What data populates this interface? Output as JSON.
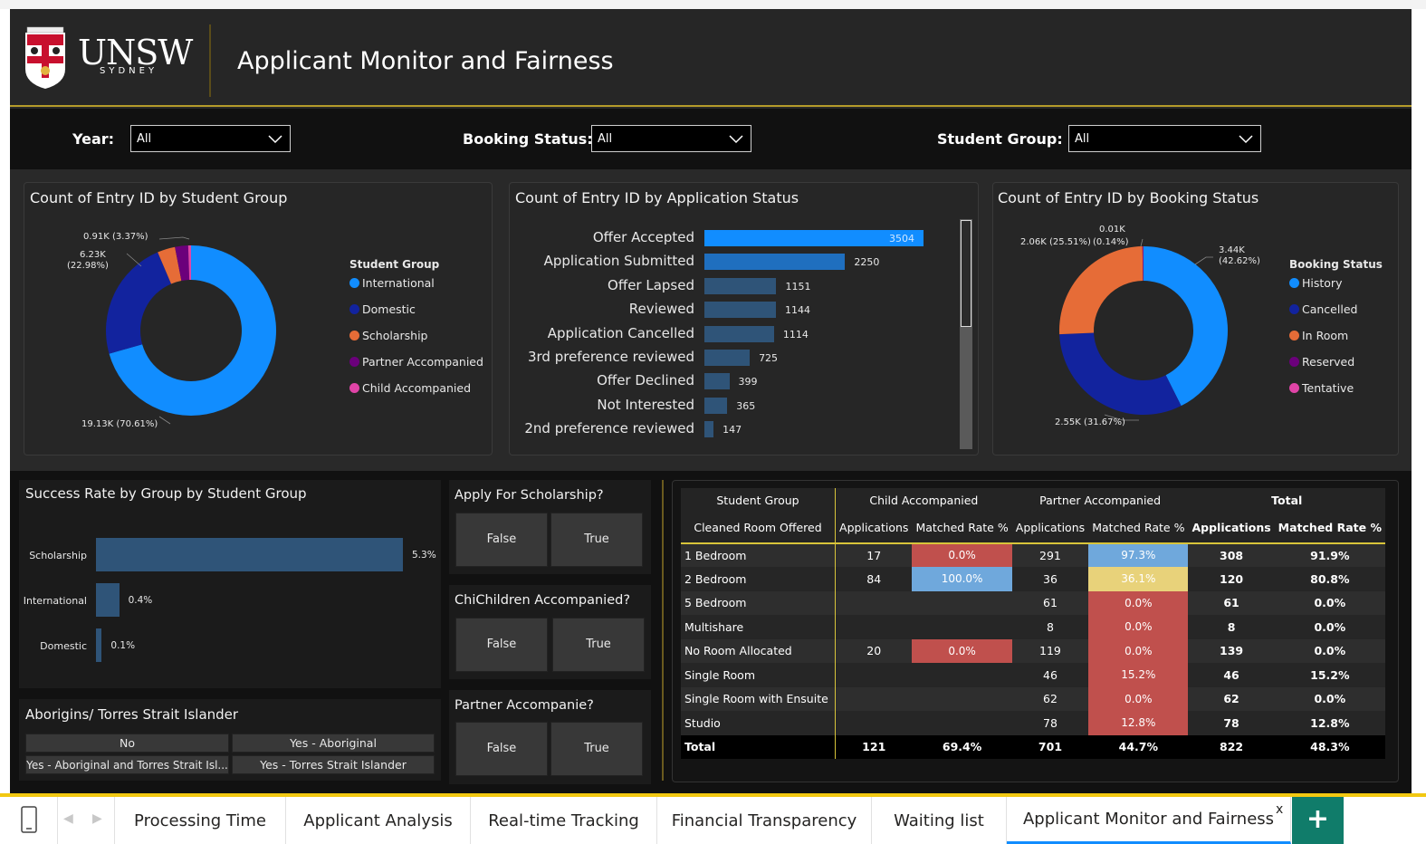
{
  "header": {
    "logo_text": "UNSW",
    "logo_subtext": "SYDNEY",
    "title": "Applicant Monitor and Fairness"
  },
  "filters": {
    "year_label": "Year:",
    "year_value": "All",
    "booking_label": "Booking Status:",
    "booking_value": "All",
    "group_label": "Student Group:",
    "group_value": "All"
  },
  "donut_group": {
    "title": "Count of Entry ID by Student Group",
    "labels": {
      "international": "19.13K (70.61%)",
      "domestic_1": "6.23K",
      "domestic_2": "(22.98%)",
      "scholarship": "0.91K (3.37%)"
    },
    "legend_title": "Student Group",
    "legend": [
      "International",
      "Domestic",
      "Scholarship",
      "Partner Accompanied",
      "Child Accompanied"
    ],
    "colors": [
      "#118dff",
      "#12239e",
      "#e66c37",
      "#6b007b",
      "#e044a7"
    ],
    "chart_data": {
      "type": "pie",
      "categories": [
        "International",
        "Domestic",
        "Scholarship",
        "Partner Accompanied",
        "Child Accompanied"
      ],
      "values": [
        70.61,
        22.98,
        3.37,
        2.5,
        0.54
      ]
    }
  },
  "bar_status": {
    "title": "Count of Entry ID by Application Status",
    "chart_data": {
      "type": "bar",
      "categories": [
        "Offer Accepted",
        "Application Submitted",
        "Offer Lapsed",
        "Reviewed",
        "Application Cancelled",
        "3rd preference reviewed",
        "Offer Declined",
        "Not Interested",
        "2nd preference reviewed"
      ],
      "values": [
        3504,
        2250,
        1151,
        1144,
        1114,
        725,
        399,
        365,
        147
      ],
      "xlim": [
        0,
        3504
      ]
    },
    "value_labels": [
      "3504",
      "2250",
      "1151",
      "1144",
      "1114",
      "725",
      "399",
      "365",
      "147"
    ]
  },
  "donut_booking": {
    "title": "Count of Entry ID by Booking Status",
    "labels": {
      "history_1": "3.44K",
      "history_2": "(42.62%)",
      "cancelled": "2.55K (31.67%)",
      "inroom": "2.06K (25.51%)",
      "reserved_1": "0.01K",
      "reserved_2": "(0.14%)"
    },
    "legend_title": "Booking Status",
    "legend": [
      "History",
      "Cancelled",
      "In Room",
      "Reserved",
      "Tentative"
    ],
    "colors": [
      "#118dff",
      "#12239e",
      "#e66c37",
      "#6b007b",
      "#e044a7"
    ],
    "chart_data": {
      "type": "pie",
      "categories": [
        "History",
        "Cancelled",
        "In Room",
        "Reserved",
        "Tentative"
      ],
      "values": [
        42.62,
        31.67,
        25.51,
        0.14,
        0.06
      ]
    }
  },
  "success_rate": {
    "title": "Success Rate by Group by Student Group",
    "chart_data": {
      "type": "bar",
      "categories": [
        "Scholarship",
        "International",
        "Domestic"
      ],
      "values": [
        5.3,
        0.4,
        0.1
      ],
      "xlim": [
        0,
        5.3
      ]
    },
    "value_labels": [
      "5.3%",
      "0.4%",
      "0.1%"
    ]
  },
  "aboriginal": {
    "title": "Aborigins/ Torres Strait Islander",
    "options": [
      "No",
      "Yes - Aboriginal",
      "Yes - Aboriginal and Torres Strait Isl...",
      "Yes - Torres Strait Islander"
    ]
  },
  "slicers": [
    {
      "title": "Apply For Scholarship?",
      "false_label": "False",
      "true_label": "True"
    },
    {
      "title": "ChiChildren Accompanied?",
      "false_label": "False",
      "true_label": "True"
    },
    {
      "title": "Partner Accompanie?",
      "false_label": "False",
      "true_label": "True"
    }
  ],
  "matrix": {
    "h_group": "Student Group",
    "h_room": "Cleaned Room Offered",
    "h_child": "Child Accompanied",
    "h_partner": "Partner Accompanied",
    "h_total": "Total",
    "h_apps": "Applications",
    "h_rate": "Matched Rate %",
    "rows": [
      {
        "room": "1 Bedroom",
        "c_apps": "17",
        "c_rate": "0.0%",
        "p_apps": "291",
        "p_rate": "97.3%",
        "t_apps": "308",
        "t_rate": "91.9%"
      },
      {
        "room": "2 Bedroom",
        "c_apps": "84",
        "c_rate": "100.0%",
        "p_apps": "36",
        "p_rate": "36.1%",
        "t_apps": "120",
        "t_rate": "80.8%"
      },
      {
        "room": "5 Bedroom",
        "c_apps": "",
        "c_rate": "",
        "p_apps": "61",
        "p_rate": "0.0%",
        "t_apps": "61",
        "t_rate": "0.0%"
      },
      {
        "room": "Multishare",
        "c_apps": "",
        "c_rate": "",
        "p_apps": "8",
        "p_rate": "0.0%",
        "t_apps": "8",
        "t_rate": "0.0%"
      },
      {
        "room": "No Room Allocated",
        "c_apps": "20",
        "c_rate": "0.0%",
        "p_apps": "119",
        "p_rate": "0.0%",
        "t_apps": "139",
        "t_rate": "0.0%"
      },
      {
        "room": "Single Room",
        "c_apps": "",
        "c_rate": "",
        "p_apps": "46",
        "p_rate": "15.2%",
        "t_apps": "46",
        "t_rate": "15.2%"
      },
      {
        "room": "Single Room with Ensuite",
        "c_apps": "",
        "c_rate": "",
        "p_apps": "62",
        "p_rate": "0.0%",
        "t_apps": "62",
        "t_rate": "0.0%"
      },
      {
        "room": "Studio",
        "c_apps": "",
        "c_rate": "",
        "p_apps": "78",
        "p_rate": "12.8%",
        "t_apps": "78",
        "t_rate": "12.8%"
      }
    ],
    "total": {
      "room": "Total",
      "c_apps": "121",
      "c_rate": "69.4%",
      "p_apps": "701",
      "p_rate": "44.7%",
      "t_apps": "822",
      "t_rate": "48.3%"
    },
    "cell_colors": {
      "red": "#c0504d",
      "blue": "#6fa8dc",
      "yellow": "#e8d27a"
    }
  },
  "tabs": {
    "items": [
      "Processing Time",
      "Applicant Analysis",
      "Real-time Tracking",
      "Financial Transparency",
      "Waiting list",
      "Applicant Monitor and Fairness"
    ],
    "active": "Applicant Monitor and Fairness",
    "close_glyph": "x",
    "add_glyph": "+"
  }
}
